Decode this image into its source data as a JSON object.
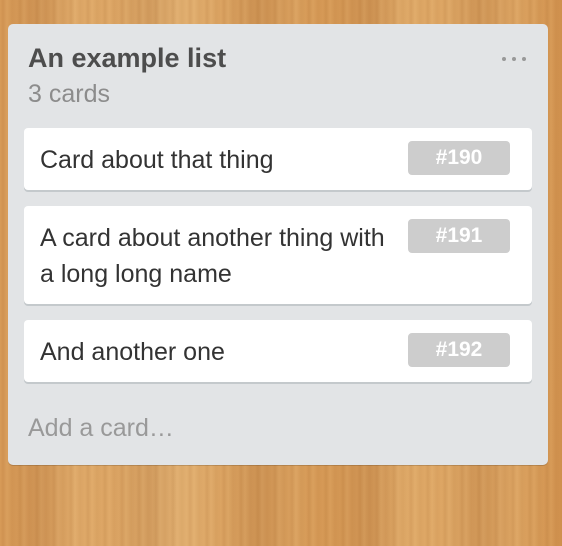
{
  "list": {
    "title": "An example list",
    "count": "3 cards",
    "menu_icon": "more-dots-icon",
    "add_card_label": "Add a card…",
    "cards": [
      {
        "title": "Card about that thing",
        "badge": "#190"
      },
      {
        "title": "A card about another thing with a long long name",
        "badge": "#191"
      },
      {
        "title": "And another one",
        "badge": "#192"
      }
    ]
  },
  "colors": {
    "list_background": "#e2e4e6",
    "card_background": "#ffffff",
    "badge_background": "#cdcdcd",
    "title_text": "#4d4d4d",
    "muted_text": "#8c8c8c"
  }
}
